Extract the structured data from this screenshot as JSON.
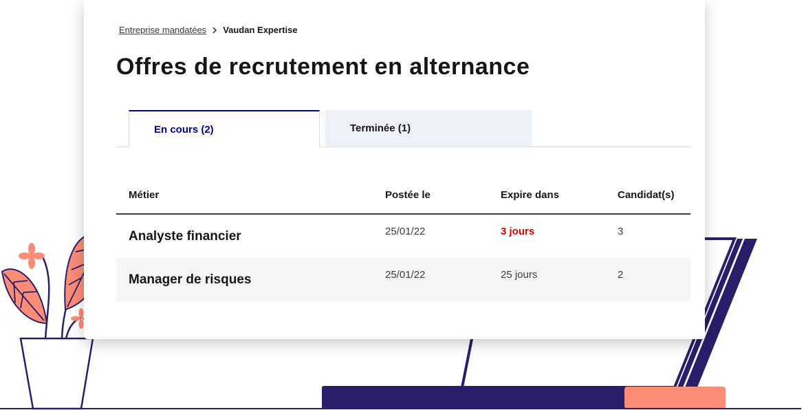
{
  "breadcrumb": {
    "parent": "Entreprise mandatées",
    "current": "Vaudan Expertise"
  },
  "page_title": "Offres de recrutement en alternance",
  "tabs": [
    {
      "label": "En cours (2)",
      "active": true
    },
    {
      "label": "Terminée (1)",
      "active": false
    }
  ],
  "table": {
    "headers": [
      "Métier",
      "Postée le",
      "Expire dans",
      "Candidat(s)"
    ],
    "rows": [
      {
        "metier": "Analyste financier",
        "postee": "25/01/22",
        "expire": "3 jours",
        "candidats": "3",
        "urgent": true
      },
      {
        "metier": "Manager de risques",
        "postee": "25/01/22",
        "expire": "25 jours",
        "candidats": "2",
        "urgent": false
      }
    ]
  },
  "colors": {
    "primary_blue": "#000091",
    "urgent_red": "#ce0500",
    "laptop_navy": "#2a1e6b",
    "accent_coral": "#fa8c78"
  }
}
